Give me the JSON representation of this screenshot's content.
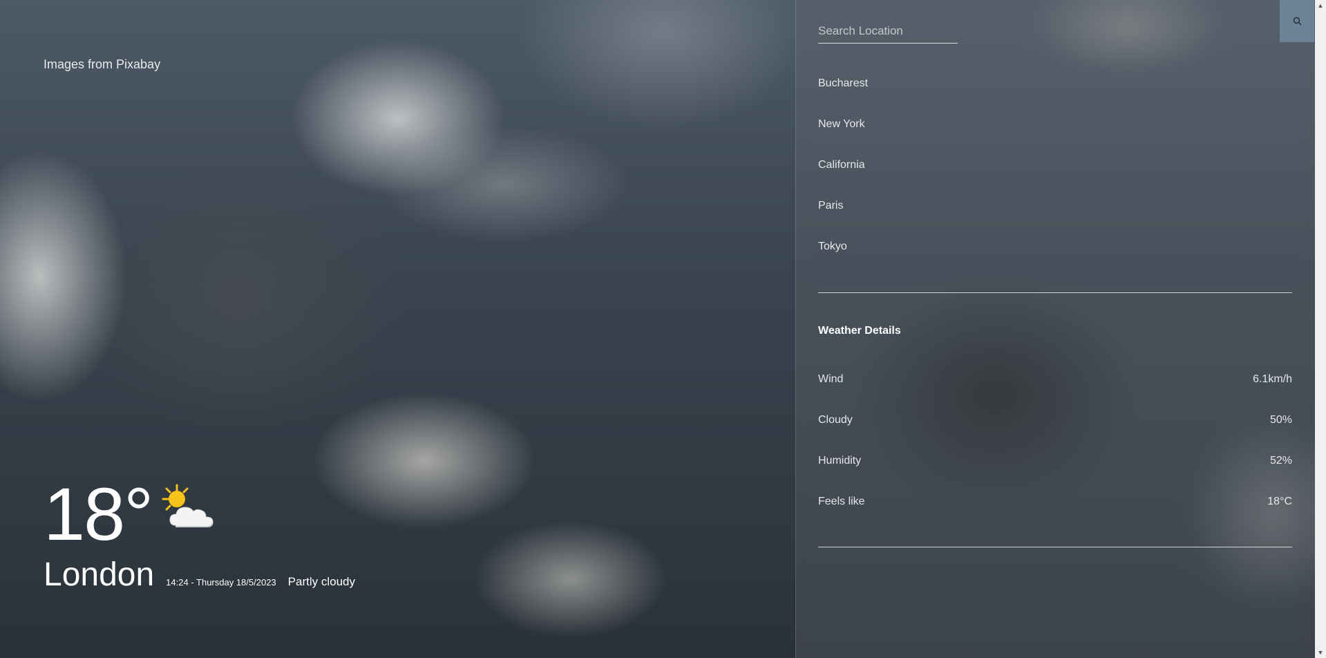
{
  "credit": {
    "text": "Images from Pixabay"
  },
  "current": {
    "temperature": "18°",
    "icon": "partly-cloudy-icon",
    "city": "London",
    "datetime": "14:24 - Thursday 18/5/2023",
    "condition": "Partly cloudy"
  },
  "search": {
    "placeholder": "Search Location",
    "value": "",
    "button_icon": "search-icon"
  },
  "locations": [
    "Bucharest",
    "New York",
    "California",
    "Paris",
    "Tokyo"
  ],
  "details": {
    "title": "Weather Details",
    "rows": [
      {
        "label": "Wind",
        "value": "6.1km/h"
      },
      {
        "label": "Cloudy",
        "value": "50%"
      },
      {
        "label": "Humidity",
        "value": "52%"
      },
      {
        "label": "Feels like",
        "value": "18°C"
      }
    ]
  },
  "colors": {
    "search_button": "#6b8396",
    "text": "#ffffff",
    "sun": "#f7c21a"
  }
}
